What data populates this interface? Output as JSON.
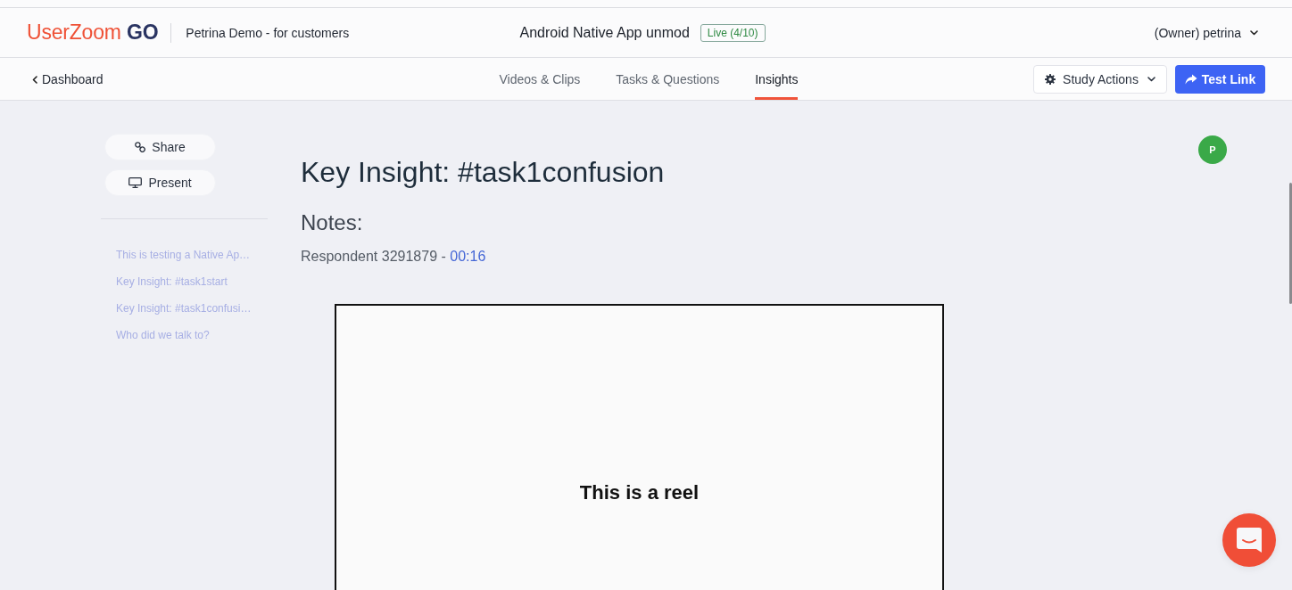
{
  "header": {
    "logo": {
      "brand": "UserZoom",
      "product": "GO"
    },
    "project": "Petrina Demo - for customers",
    "study_title": "Android Native App unmod",
    "status_badge": "Live (4/10)",
    "user_menu": "(Owner) petrina"
  },
  "nav": {
    "back_link": "Dashboard",
    "tabs": [
      {
        "label": "Videos & Clips",
        "selected": false
      },
      {
        "label": "Tasks & Questions",
        "selected": false
      },
      {
        "label": "Insights",
        "selected": true
      }
    ],
    "study_actions": "Study Actions",
    "test_link": "Test Link"
  },
  "sidebar": {
    "actions": [
      {
        "label": "Share",
        "kind": "share"
      },
      {
        "label": "Present",
        "kind": "present"
      }
    ],
    "toc": [
      {
        "label": "This is testing a Native Ap…"
      },
      {
        "label": "Key Insight: #task1start"
      },
      {
        "label": "Key Insight: #task1confusi…"
      },
      {
        "label": "Who did we talk to?"
      }
    ]
  },
  "insight": {
    "title": "Key Insight: #task1confusion",
    "notes_label": "Notes:",
    "respondent": "Respondent 3291879 -",
    "timestamp": "00:16",
    "reel_text": "This is a reel"
  },
  "avatar": {
    "initial": "P"
  }
}
